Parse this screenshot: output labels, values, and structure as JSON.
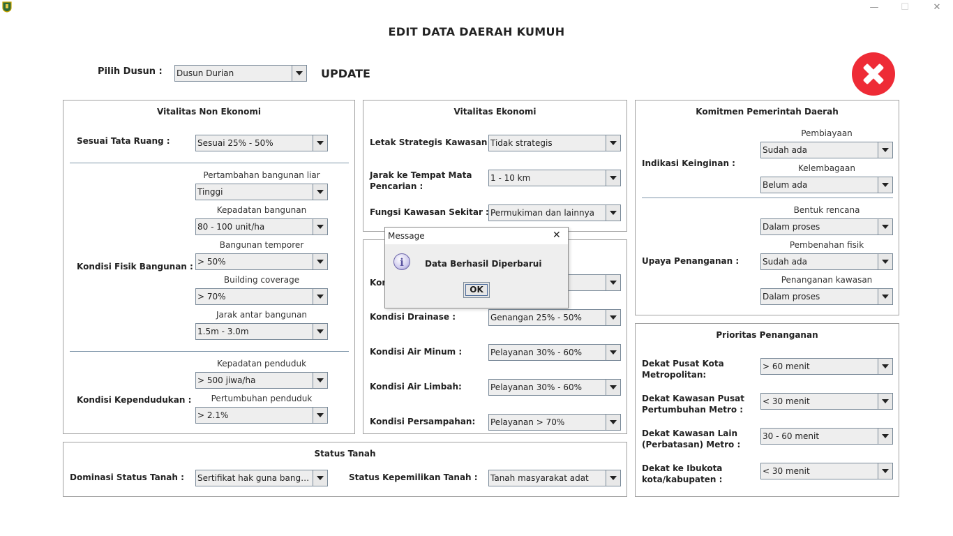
{
  "window": {
    "minimize": "—",
    "maximize": "☐",
    "close": "✕"
  },
  "page_title": "EDIT DATA DAERAH KUMUH",
  "header": {
    "pilih_dusun_label": "Pilih Dusun :",
    "dusun_value": "Dusun Durian",
    "update_label": "UPDATE"
  },
  "non_ekonomi": {
    "title": "Vitalitas Non Ekonomi",
    "tata_ruang_label": "Sesuai Tata Ruang :",
    "tata_ruang_value": "Sesuai 25% - 50%",
    "fisik_label": "Kondisi Fisik Bangunan :",
    "liar_label": "Pertambahan bangunan liar",
    "liar_value": "Tinggi",
    "kepadatan_label": "Kepadatan bangunan",
    "kepadatan_value": "80 - 100 unit/ha",
    "temporer_label": "Bangunan temporer",
    "temporer_value": "> 50%",
    "coverage_label": "Building coverage",
    "coverage_value": "> 70%",
    "jarak_label": "Jarak antar bangunan",
    "jarak_value": "1.5m - 3.0m",
    "kependudukan_label": "Kondisi Kependudukan :",
    "kep_penduduk_label": "Kepadatan penduduk",
    "kep_penduduk_value": "> 500 jiwa/ha",
    "pertumbuhan_label": "Pertumbuhan penduduk",
    "pertumbuhan_value": "> 2.1%"
  },
  "ekonomi": {
    "title": "Vitalitas Ekonomi",
    "letak_label": "Letak Strategis Kawasan :",
    "letak_value": "Tidak strategis",
    "jarak_label_1": "Jarak ke Tempat Mata",
    "jarak_label_2": "Pencarian :",
    "jarak_value": "1 - 10 km",
    "fungsi_label": "Fungsi Kawasan Sekitar :",
    "fungsi_value": "Permukiman dan lainnya"
  },
  "prasarana": {
    "kondisi_partial_label": "Kond",
    "drainase_label": "Kondisi Drainase :",
    "drainase_value": "Genangan 25% - 50%",
    "air_minum_label": "Kondisi Air Minum :",
    "air_minum_value": "Pelayanan 30% - 60%",
    "air_limbah_label": "Kondisi Air Limbah:",
    "air_limbah_value": "Pelayanan 30% - 60%",
    "sampah_label": "Kondisi Persampahan:",
    "sampah_value": "Pelayanan > 70%"
  },
  "komitmen": {
    "title": "Komitmen Pemerintah Daerah",
    "indikasi_label": "Indikasi Keinginan :",
    "pembiayaan_label": "Pembiayaan",
    "pembiayaan_value": "Sudah ada",
    "kelembagaan_label": "Kelembagaan",
    "kelembagaan_value": "Belum ada",
    "upaya_label": "Upaya Penanganan :",
    "rencana_label": "Bentuk rencana",
    "rencana_value": "Dalam proses",
    "pembenahan_label": "Pembenahan fisik",
    "pembenahan_value": "Sudah ada",
    "penanganan_label": "Penanganan kawasan",
    "penanganan_value": "Dalam proses"
  },
  "prioritas": {
    "title": "Prioritas Penanganan",
    "pusat_label_1": "Dekat Pusat Kota",
    "pusat_label_2": "Metropolitan:",
    "pusat_value": "> 60 menit",
    "kawasan_label_1": "Dekat Kawasan Pusat",
    "kawasan_label_2": "Pertumbuhan Metro :",
    "kawasan_value": "< 30 menit",
    "lain_label_1": "Dekat Kawasan Lain",
    "lain_label_2": "(Perbatasan) Metro :",
    "lain_value": "30 - 60 menit",
    "ibukota_label_1": "Dekat ke Ibukota",
    "ibukota_label_2": "kota/kabupaten :",
    "ibukota_value": "< 30 menit"
  },
  "status_tanah": {
    "title": "Status Tanah",
    "dominasi_label": "Dominasi Status Tanah :",
    "dominasi_value": "Sertifikat hak guna bangu...",
    "kepemilikan_label": "Status Kepemilikan Tanah :",
    "kepemilikan_value": "Tanah masyarakat adat"
  },
  "dialog": {
    "title": "Message",
    "close": "✕",
    "info_symbol": "i",
    "message": "Data Berhasil Diperbarui",
    "ok_label": "OK"
  },
  "colors": {
    "close_button": "#ee2b36",
    "separator": "#7f96aa",
    "info_icon": "#8a84c8"
  }
}
